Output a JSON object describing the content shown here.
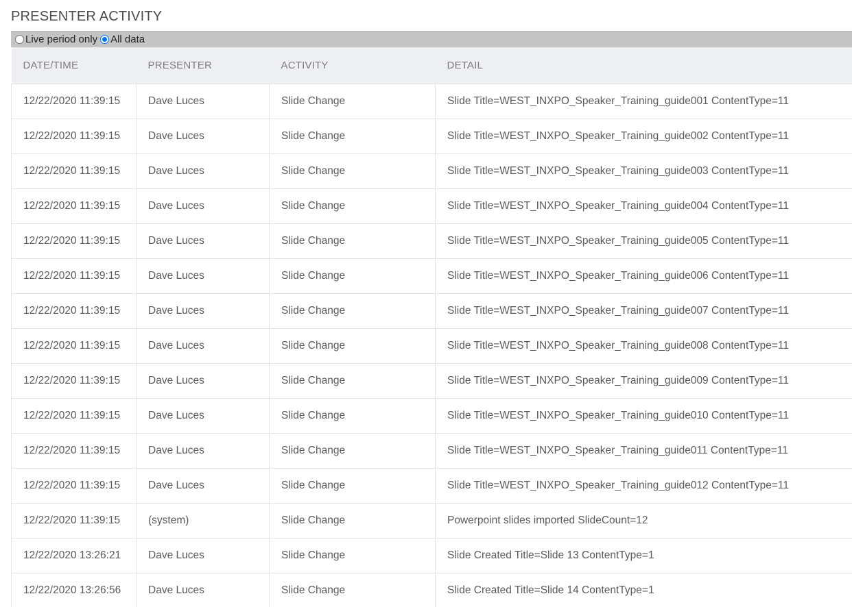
{
  "page": {
    "title": "PRESENTER ACTIVITY"
  },
  "filter": {
    "options": [
      {
        "label": "Live period only",
        "selected": false
      },
      {
        "label": "All data",
        "selected": true
      }
    ]
  },
  "table": {
    "headers": [
      "DATE/TIME",
      "PRESENTER",
      "ACTIVITY",
      "DETAIL"
    ],
    "rows": [
      [
        "12/22/2020 11:39:15",
        "Dave Luces",
        "Slide Change",
        "Slide Title=WEST_INXPO_Speaker_Training_guide001 ContentType=11"
      ],
      [
        "12/22/2020 11:39:15",
        "Dave Luces",
        "Slide Change",
        "Slide Title=WEST_INXPO_Speaker_Training_guide002 ContentType=11"
      ],
      [
        "12/22/2020 11:39:15",
        "Dave Luces",
        "Slide Change",
        "Slide Title=WEST_INXPO_Speaker_Training_guide003 ContentType=11"
      ],
      [
        "12/22/2020 11:39:15",
        "Dave Luces",
        "Slide Change",
        "Slide Title=WEST_INXPO_Speaker_Training_guide004 ContentType=11"
      ],
      [
        "12/22/2020 11:39:15",
        "Dave Luces",
        "Slide Change",
        "Slide Title=WEST_INXPO_Speaker_Training_guide005 ContentType=11"
      ],
      [
        "12/22/2020 11:39:15",
        "Dave Luces",
        "Slide Change",
        "Slide Title=WEST_INXPO_Speaker_Training_guide006 ContentType=11"
      ],
      [
        "12/22/2020 11:39:15",
        "Dave Luces",
        "Slide Change",
        "Slide Title=WEST_INXPO_Speaker_Training_guide007 ContentType=11"
      ],
      [
        "12/22/2020 11:39:15",
        "Dave Luces",
        "Slide Change",
        "Slide Title=WEST_INXPO_Speaker_Training_guide008 ContentType=11"
      ],
      [
        "12/22/2020 11:39:15",
        "Dave Luces",
        "Slide Change",
        "Slide Title=WEST_INXPO_Speaker_Training_guide009 ContentType=11"
      ],
      [
        "12/22/2020 11:39:15",
        "Dave Luces",
        "Slide Change",
        "Slide Title=WEST_INXPO_Speaker_Training_guide010 ContentType=11"
      ],
      [
        "12/22/2020 11:39:15",
        "Dave Luces",
        "Slide Change",
        "Slide Title=WEST_INXPO_Speaker_Training_guide011 ContentType=11"
      ],
      [
        "12/22/2020 11:39:15",
        "Dave Luces",
        "Slide Change",
        "Slide Title=WEST_INXPO_Speaker_Training_guide012 ContentType=11"
      ],
      [
        "12/22/2020 11:39:15",
        "(system)",
        "Slide Change",
        "Powerpoint slides imported SlideCount=12"
      ],
      [
        "12/22/2020 13:26:21",
        "Dave Luces",
        "Slide Change",
        "Slide Created Title=Slide 13 ContentType=1"
      ],
      [
        "12/22/2020 13:26:56",
        "Dave Luces",
        "Slide Change",
        "Slide Created Title=Slide 14 ContentType=1"
      ]
    ]
  }
}
